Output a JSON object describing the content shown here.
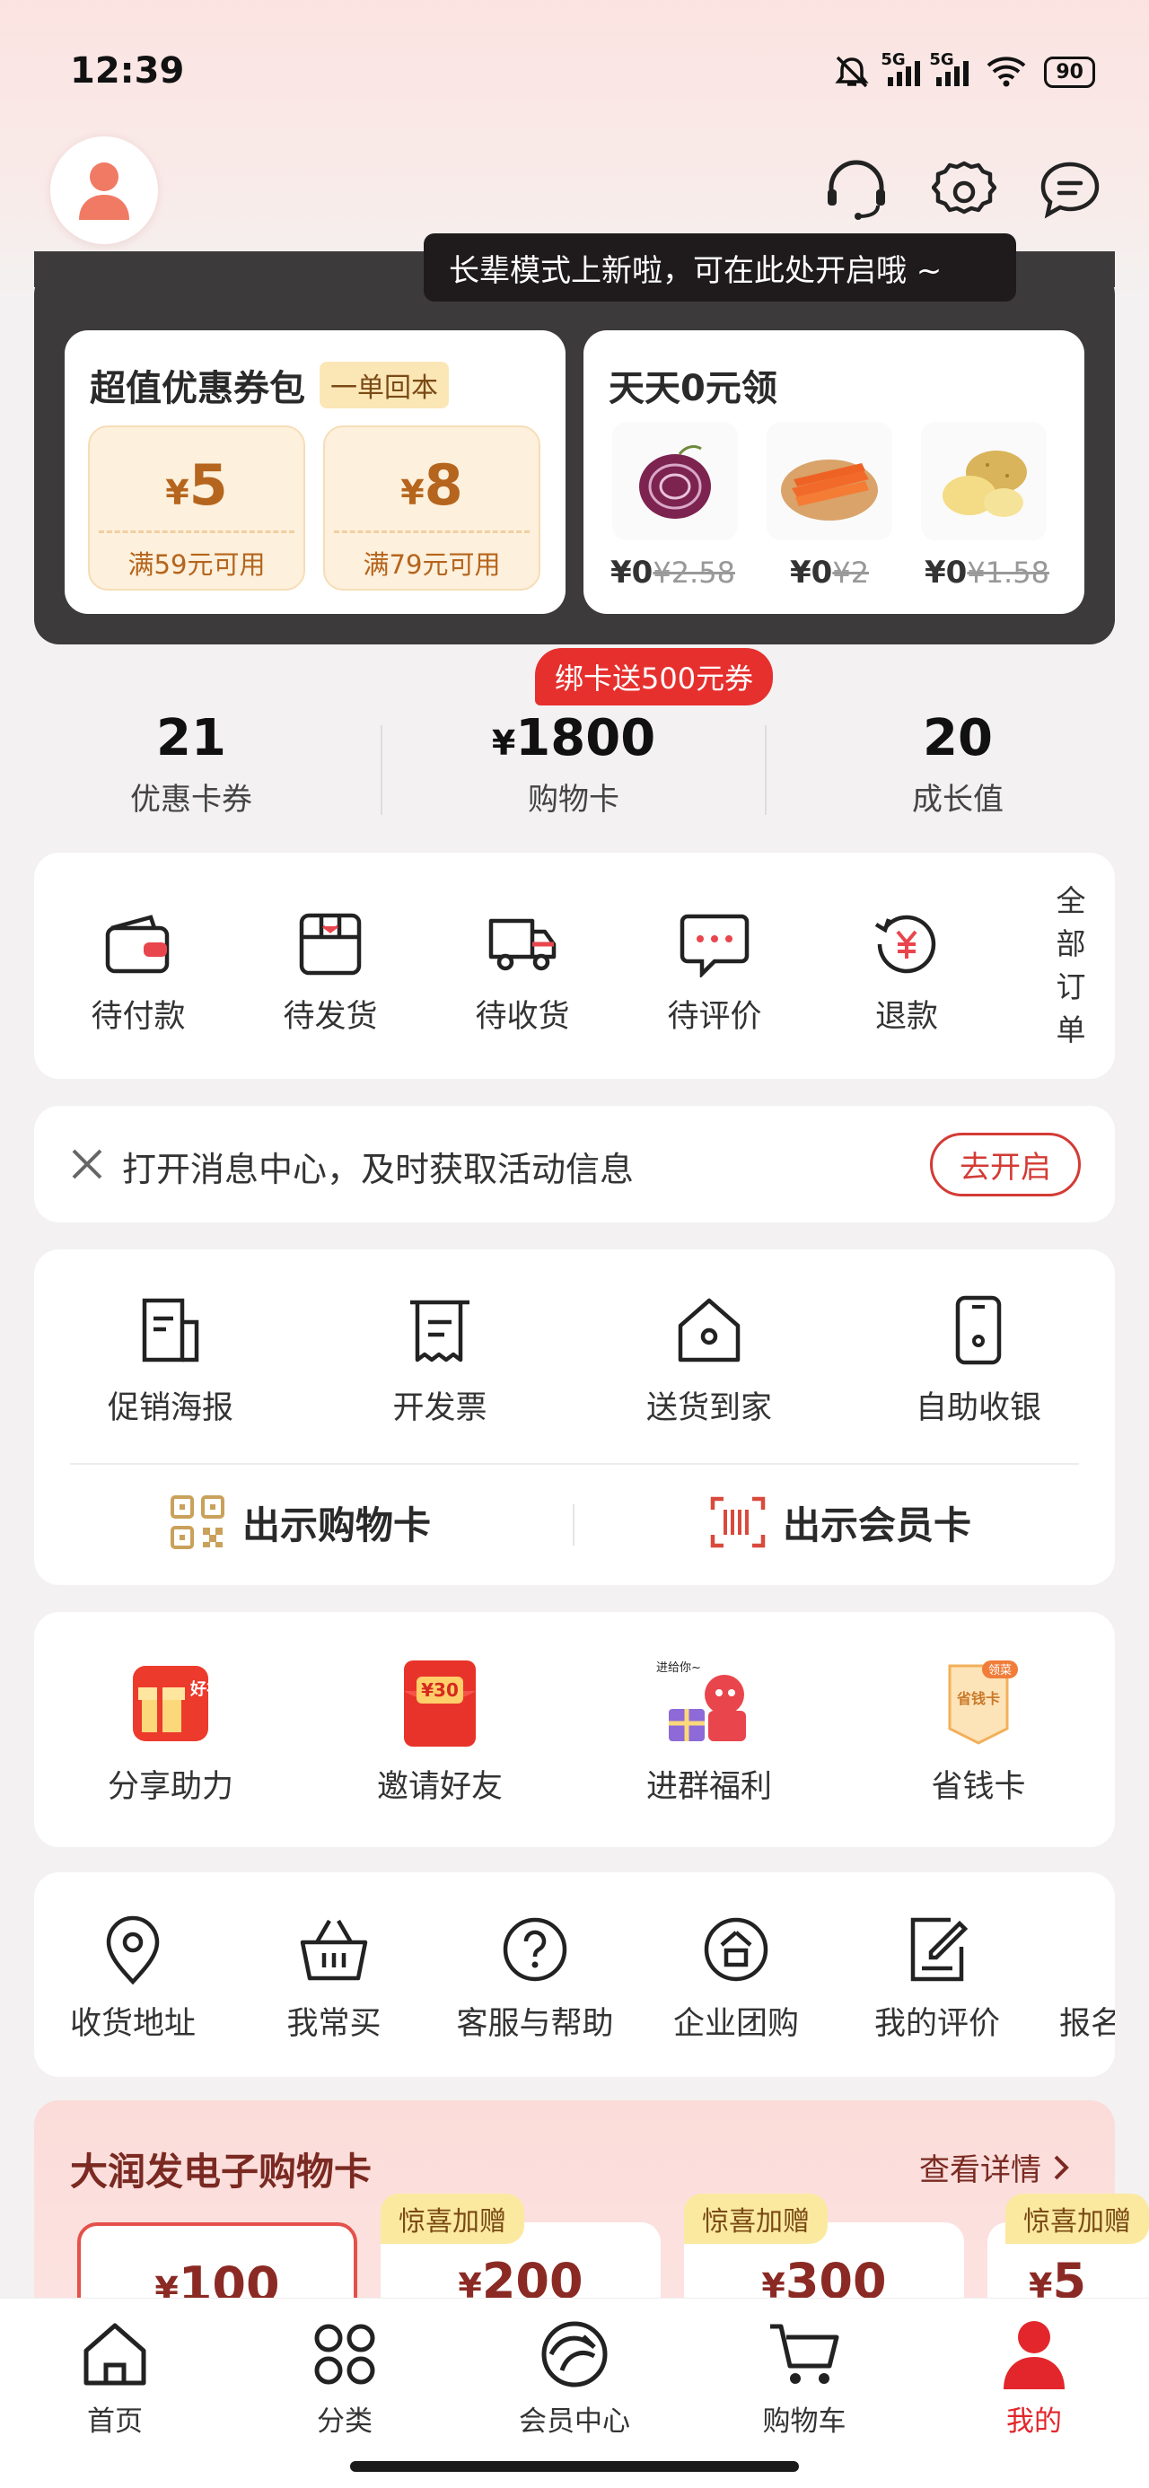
{
  "status_bar": {
    "time": "12:39",
    "net1": "5G",
    "net2": "5G",
    "battery": "90"
  },
  "tooltip": {
    "text": "长辈模式上新啦，可在此处开启哦 ~"
  },
  "coupon_pack": {
    "title": "超值优惠券包",
    "tag": "一单回本",
    "coupons": [
      {
        "currency": "¥",
        "amount": "5",
        "condition": "满59元可用"
      },
      {
        "currency": "¥",
        "amount": "8",
        "condition": "满79元可用"
      }
    ]
  },
  "free_daily": {
    "title": "天天0元领",
    "items": [
      {
        "name": "red-onion",
        "price": "¥0",
        "original": "¥2.58"
      },
      {
        "name": "carrot",
        "price": "¥0",
        "original": "¥2"
      },
      {
        "name": "potato",
        "price": "¥0",
        "original": "¥1.58"
      }
    ]
  },
  "promo_badge": "绑卡送500元券",
  "stats": [
    {
      "value": "21",
      "label": "优惠卡券"
    },
    {
      "prefix": "¥",
      "value": "1800",
      "label": "购物卡"
    },
    {
      "value": "20",
      "label": "成长值"
    }
  ],
  "orders": {
    "items": [
      "待付款",
      "待发货",
      "待收货",
      "待评价",
      "退款"
    ],
    "all_orders": [
      "全",
      "部",
      "订",
      "单"
    ]
  },
  "notice": {
    "text": "打开消息中心，及时获取活动信息",
    "button": "去开启"
  },
  "services": {
    "items": [
      "促销海报",
      "开发票",
      "送货到家",
      "自助收银"
    ],
    "show_shopping_card": "出示购物卡",
    "show_member_card": "出示会员卡"
  },
  "promotions": {
    "items": [
      "分享助力",
      "邀请好友",
      "进群福利",
      "省钱卡"
    ],
    "badge_haoli": "好礼",
    "badge_30": "¥30",
    "badge_group": "进给你~",
    "badge_card": "领菜",
    "card_text": "省钱卡"
  },
  "tools": [
    "收货地址",
    "我常买",
    "客服与帮助",
    "企业团购",
    "我的评价",
    "报名"
  ],
  "gift_cards": {
    "title": "大润发电子购物卡",
    "link": "查看详情",
    "cards": [
      {
        "tag": "",
        "currency": "¥",
        "amount": "100"
      },
      {
        "tag": "惊喜加赠",
        "currency": "¥",
        "amount": "200"
      },
      {
        "tag": "惊喜加赠",
        "currency": "¥",
        "amount": "300"
      },
      {
        "tag": "惊喜加赠",
        "currency": "¥",
        "amount": "5"
      }
    ]
  },
  "tabbar": [
    "首页",
    "分类",
    "会员中心",
    "购物车",
    "我的"
  ],
  "colors": {
    "accent": "#d62b2b",
    "gold": "#b5651d",
    "dark_panel": "#3d3a3b"
  }
}
